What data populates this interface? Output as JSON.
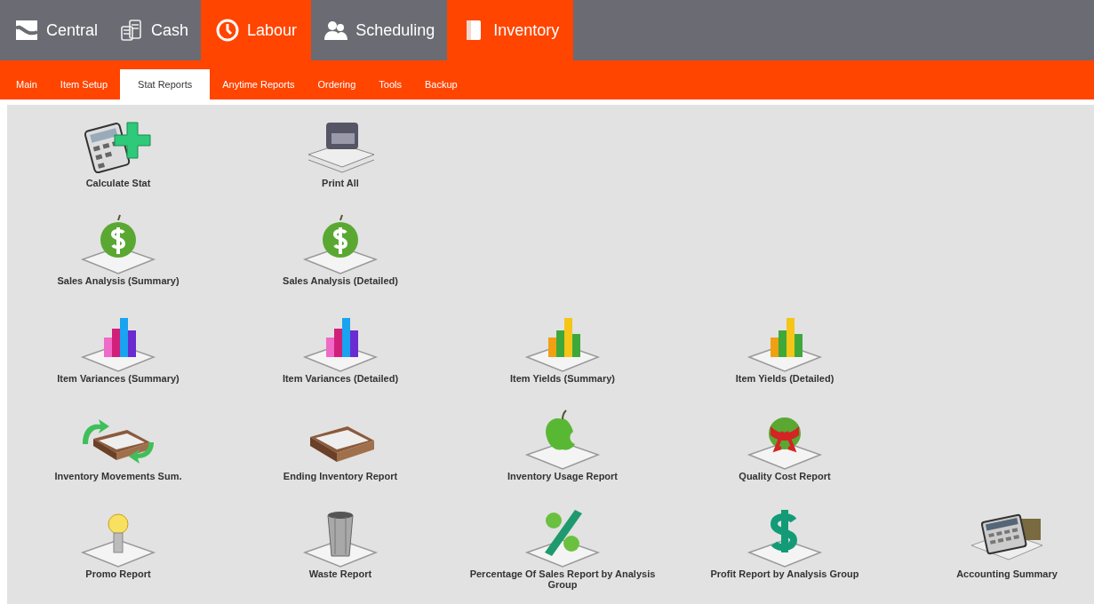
{
  "modules": [
    {
      "label": "Central",
      "kind": "wave",
      "highlighted": false
    },
    {
      "label": "Cash",
      "kind": "coins",
      "highlighted": false
    },
    {
      "label": "Labour",
      "kind": "clock",
      "highlighted": true
    },
    {
      "label": "Scheduling",
      "kind": "people",
      "highlighted": false
    },
    {
      "label": "Inventory",
      "kind": "book",
      "highlighted": true
    }
  ],
  "subtabs": [
    {
      "label": "Main",
      "selected": false
    },
    {
      "label": "Item Setup",
      "selected": false
    },
    {
      "label": "Stat Reports",
      "selected": true
    },
    {
      "label": "Anytime Reports",
      "selected": false
    },
    {
      "label": "Ordering",
      "selected": false
    },
    {
      "label": "Tools",
      "selected": false
    },
    {
      "label": "Backup",
      "selected": false
    }
  ],
  "rows": [
    {
      "items": [
        {
          "label": "Calculate Stat",
          "kind": "calc-plus"
        },
        {
          "label": "Print All",
          "kind": "printer"
        }
      ]
    },
    {
      "items": [
        {
          "label": "Sales Analysis (Summary)",
          "kind": "apple-dollar"
        },
        {
          "label": "Sales Analysis (Detailed)",
          "kind": "apple-dollar"
        }
      ]
    },
    {
      "items": [
        {
          "label": "Item Variances (Summary)",
          "kind": "bars-pink"
        },
        {
          "label": "Item Variances (Detailed)",
          "kind": "bars-pink"
        },
        {
          "label": "Item Yields (Summary)",
          "kind": "bars-yellow"
        },
        {
          "label": "Item Yields (Detailed)",
          "kind": "bars-yellow"
        }
      ]
    },
    {
      "items": [
        {
          "label": "Inventory Movements Sum.",
          "kind": "tray-arrows"
        },
        {
          "label": "Ending Inventory Report",
          "kind": "tray"
        },
        {
          "label": "Inventory Usage Report",
          "kind": "apple"
        },
        {
          "label": "Quality Cost Report",
          "kind": "apple-bow"
        }
      ]
    },
    {
      "items": [
        {
          "label": "Promo Report",
          "kind": "bulb"
        },
        {
          "label": "Waste Report",
          "kind": "bin"
        },
        {
          "label": "Percentage Of Sales Report by Analysis Group",
          "kind": "percent"
        },
        {
          "label": "Profit Report by Analysis Group",
          "kind": "dollar"
        },
        {
          "label": "Accounting Summary",
          "kind": "calc"
        }
      ]
    }
  ]
}
